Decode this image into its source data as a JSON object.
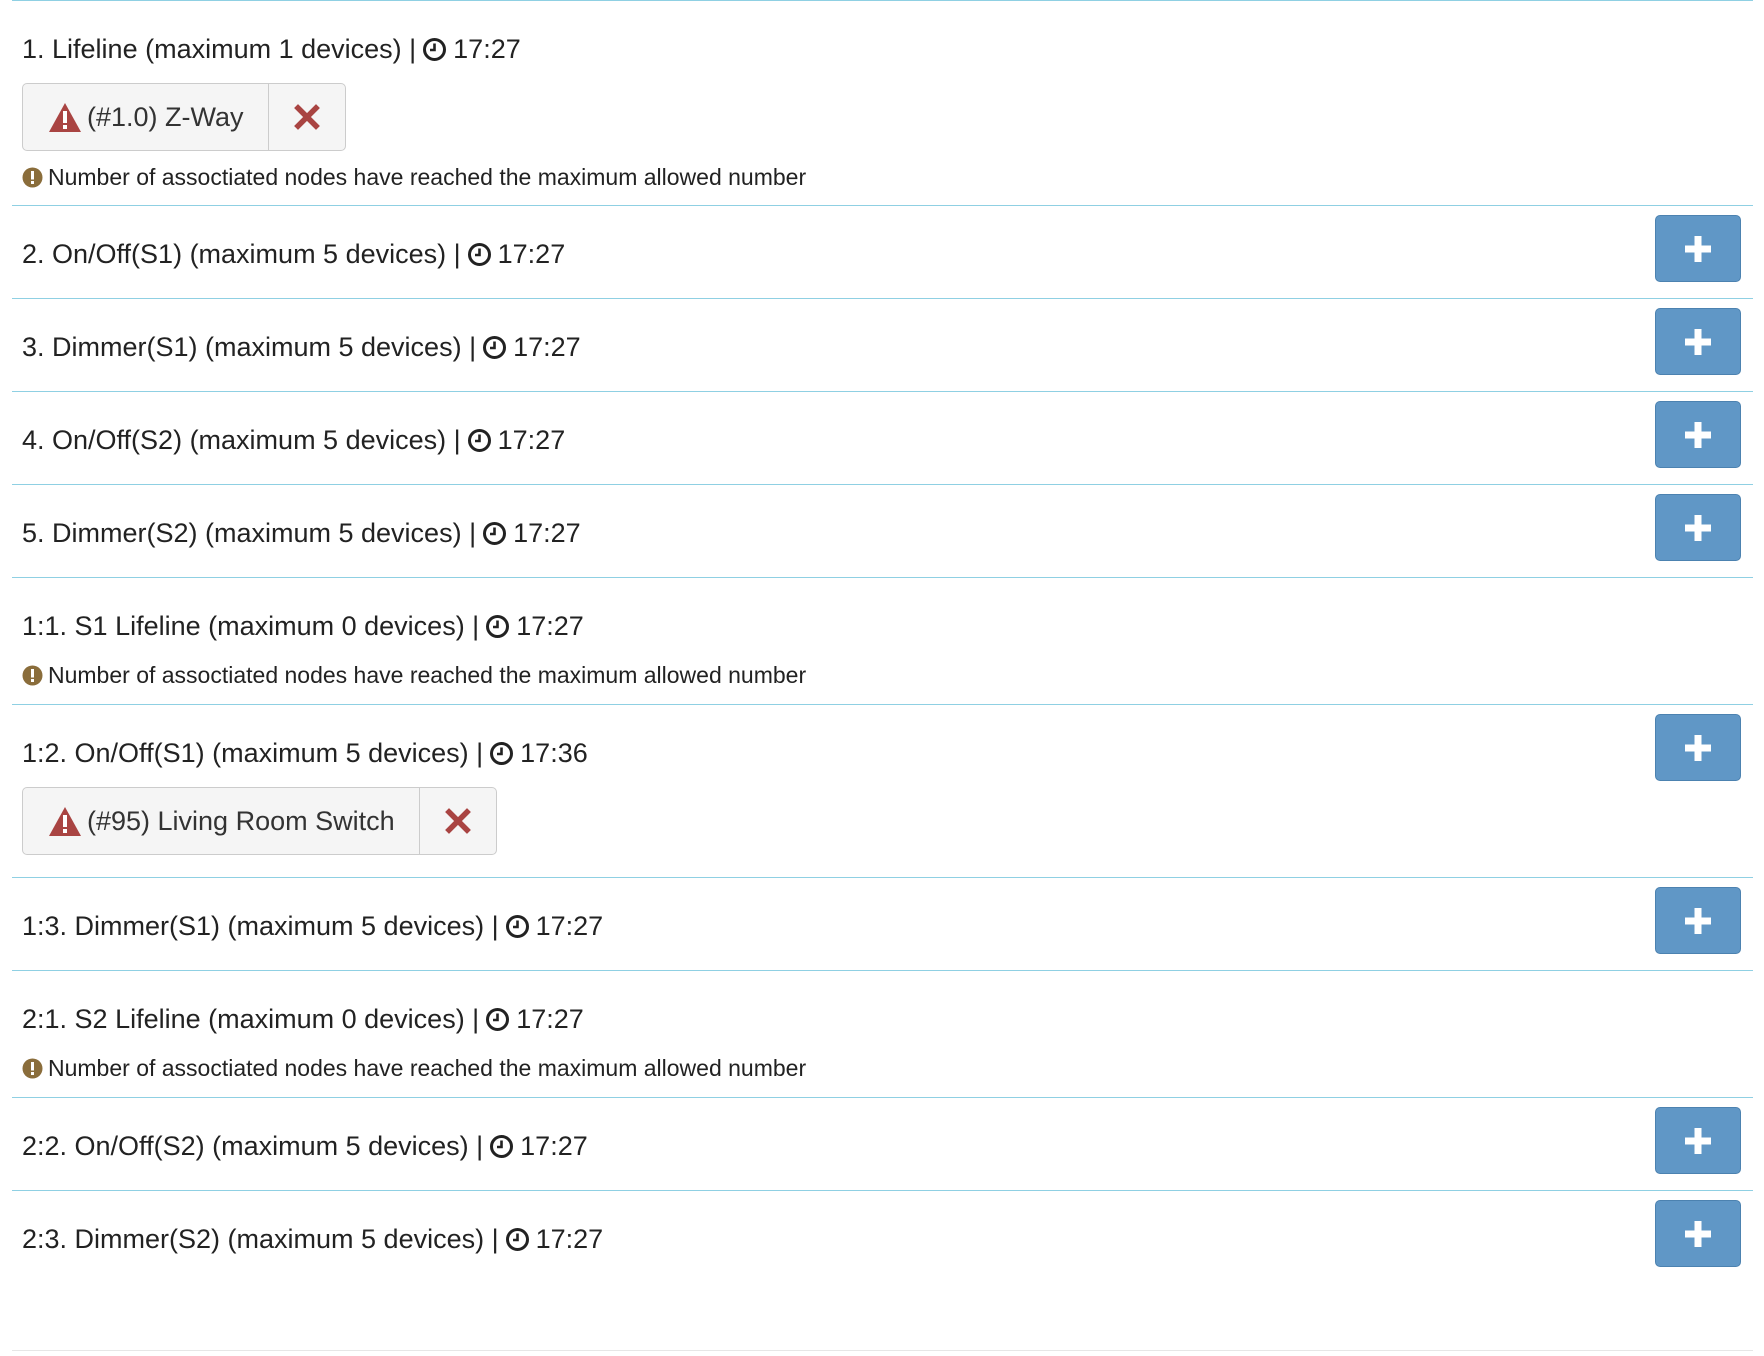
{
  "groups": [
    {
      "title": "1. Lifeline (maximum 1 devices) |",
      "time": "17:27",
      "nodes": [
        {
          "label": "(#1.0) Z-Way"
        }
      ],
      "notice": "Number of assoctiated nodes have reached the maximum allowed number",
      "add_button": false
    },
    {
      "title": "2. On/Off(S1) (maximum 5 devices) |",
      "time": "17:27",
      "add_button": true
    },
    {
      "title": "3. Dimmer(S1) (maximum 5 devices) |",
      "time": "17:27",
      "add_button": true
    },
    {
      "title": "4. On/Off(S2) (maximum 5 devices) |",
      "time": "17:27",
      "add_button": true
    },
    {
      "title": "5. Dimmer(S2) (maximum 5 devices) |",
      "time": "17:27",
      "add_button": true
    },
    {
      "title": "1:1. S1 Lifeline (maximum 0 devices) |",
      "time": "17:27",
      "notice": "Number of assoctiated nodes have reached the maximum allowed number",
      "add_button": false
    },
    {
      "title": "1:2. On/Off(S1) (maximum 5 devices) |",
      "time": "17:36",
      "nodes": [
        {
          "label": "(#95) Living Room Switch"
        }
      ],
      "add_button": true
    },
    {
      "title": "1:3. Dimmer(S1) (maximum 5 devices) |",
      "time": "17:27",
      "add_button": true
    },
    {
      "title": "2:1. S2 Lifeline (maximum 0 devices) |",
      "time": "17:27",
      "notice": "Number of assoctiated nodes have reached the maximum allowed number",
      "add_button": false
    },
    {
      "title": "2:2. On/Off(S2) (maximum 5 devices) |",
      "time": "17:27",
      "add_button": true
    },
    {
      "title": "2:3. Dimmer(S2) (maximum 5 devices) |",
      "time": "17:27",
      "add_button": true
    }
  ],
  "icons": {
    "clock": "clock-icon",
    "add": "plus-icon",
    "warning": "warning-triangle-icon",
    "remove": "close-x-icon",
    "notice": "exclamation-circle-icon"
  },
  "colors": {
    "divider": "#8fd0e3",
    "add_button": "#6097c6",
    "danger": "#a94442",
    "notice_icon": "#8a6d3b"
  }
}
